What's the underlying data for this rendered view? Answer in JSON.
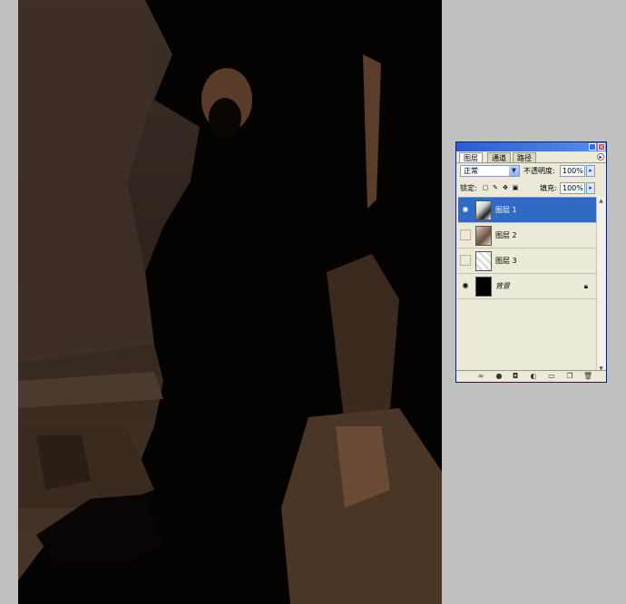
{
  "palette": {
    "tabs": [
      "图层",
      "通道",
      "路径"
    ],
    "blend_mode": "正常",
    "opacity_label": "不透明度:",
    "opacity_value": "100%",
    "lock_label": "锁定:",
    "fill_label": "填充:",
    "fill_value": "100%",
    "layers": [
      {
        "name": "图层 1",
        "visible": true,
        "selected": true
      },
      {
        "name": "图层 2",
        "visible": false,
        "selected": false
      },
      {
        "name": "图层 3",
        "visible": false,
        "selected": false
      },
      {
        "name": "背景",
        "visible": true,
        "selected": false,
        "locked": true
      }
    ]
  },
  "icons": {
    "eye": "eye-icon",
    "lock": "lock-icon",
    "link": "link-layers-icon",
    "style": "layer-style-icon",
    "mask": "add-mask-icon",
    "adjust": "adjustment-layer-icon",
    "group": "new-group-icon",
    "new": "new-layer-icon",
    "trash": "delete-layer-icon"
  }
}
